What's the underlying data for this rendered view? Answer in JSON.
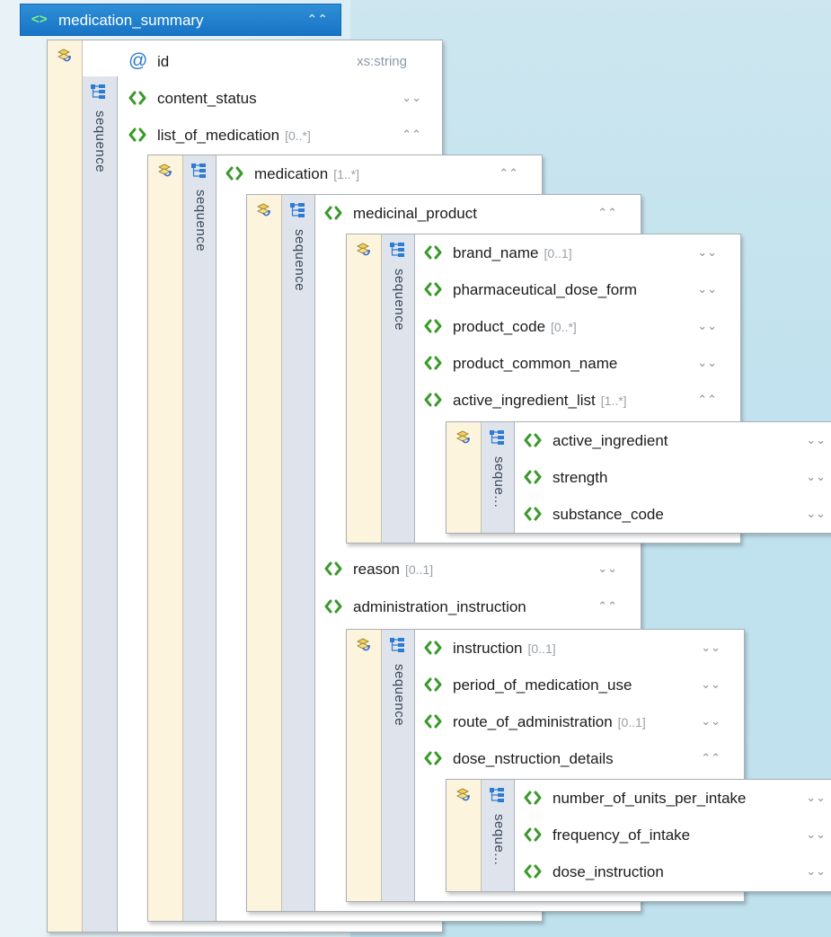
{
  "title": "medication_summary",
  "labels": {
    "sequence": "sequence",
    "sequence_short": "seque..."
  },
  "root": {
    "id": {
      "name": "id",
      "type": "xs:string"
    },
    "content_status": {
      "name": "content_status",
      "card": ""
    },
    "list_of_medication": {
      "name": "list_of_medication",
      "card": "[0..*]"
    }
  },
  "medication": {
    "name": "medication",
    "card": "[1..*]"
  },
  "medicinal_product": {
    "name": "medicinal_product",
    "card": ""
  },
  "product_fields": [
    {
      "name": "brand_name",
      "card": "[0..1]"
    },
    {
      "name": "pharmaceutical_dose_form",
      "card": ""
    },
    {
      "name": "product_code",
      "card": "[0..*]"
    },
    {
      "name": "product_common_name",
      "card": ""
    },
    {
      "name": "active_ingredient_list",
      "card": "[1..*]"
    }
  ],
  "ingredient_fields": [
    {
      "name": "active_ingredient"
    },
    {
      "name": "strength"
    },
    {
      "name": "substance_code"
    }
  ],
  "reason": {
    "name": "reason",
    "card": "[0..1]"
  },
  "administration_instruction": {
    "name": "administration_instruction"
  },
  "admin_fields": [
    {
      "name": "instruction",
      "card": "[0..1]"
    },
    {
      "name": "period_of_medication_use",
      "card": ""
    },
    {
      "name": "route_of_administration",
      "card": "[0..1]"
    },
    {
      "name": "dose_nstruction_details",
      "card": ""
    }
  ],
  "dose_fields": [
    {
      "name": "number_of_units_per_intake"
    },
    {
      "name": "frequency_of_intake"
    },
    {
      "name": "dose_instruction"
    }
  ],
  "colors": {
    "title_bar": "#1874c6",
    "element_icon": "#3a9a2a",
    "attribute_icon": "#2a7ad2",
    "attr_band": "#fcf4dd",
    "seq_band": "#dfe4ec"
  },
  "icons": {
    "element": "element-icon",
    "attribute": "attribute-icon",
    "attributes_group": "attributes-group-icon",
    "sequence": "sequence-icon",
    "collapse": "chevron-up-icon",
    "expand": "chevron-down-icon"
  }
}
